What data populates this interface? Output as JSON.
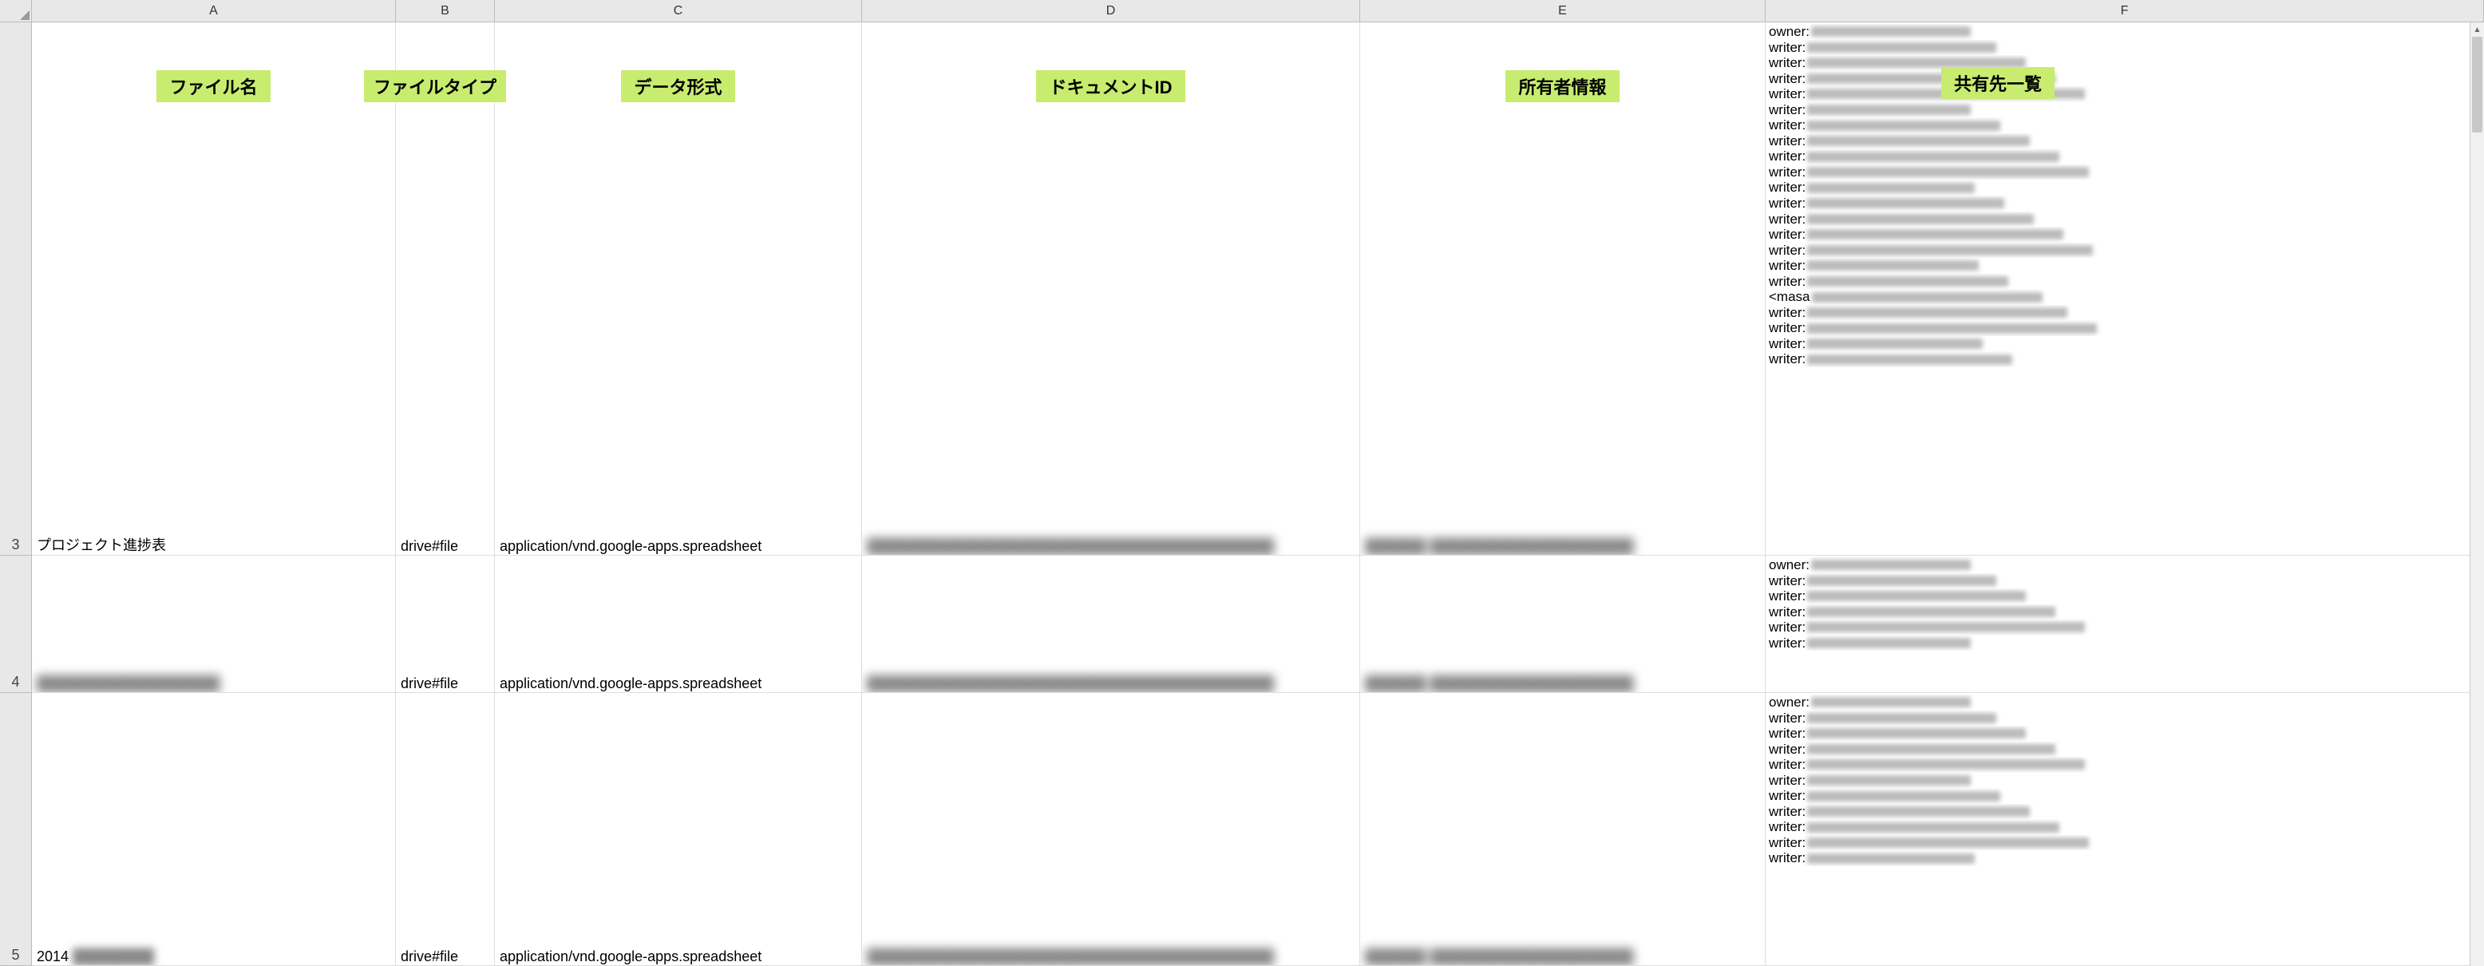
{
  "headers": {
    "A": "A",
    "B": "B",
    "C": "C",
    "D": "D",
    "E": "E",
    "F": "F"
  },
  "badges": {
    "A": "ファイル名",
    "B": "ファイルタイプ",
    "C": "データ形式",
    "D": "ドキュメントID",
    "E": "所有者情報",
    "F": "共有先一覧"
  },
  "rows": [
    {
      "num": "3",
      "A": "プロジェクト進捗表",
      "B": "drive#file",
      "C": "application/vnd.google-apps.spreadsheet",
      "D_blurred": true,
      "E_blurred": true,
      "F_prefixes": [
        "owner:",
        "writer:",
        "writer:",
        "writer:",
        "writer:",
        "writer:",
        "writer:",
        "writer:",
        "writer:",
        "writer:",
        "writer:",
        "writer:",
        "writer:",
        "writer:",
        "writer:",
        "writer:",
        "writer:",
        "<masa",
        "writer:",
        "writer:",
        "writer:",
        "writer:"
      ]
    },
    {
      "num": "4",
      "A_blurred": true,
      "B": "drive#file",
      "C": "application/vnd.google-apps.spreadsheet",
      "D_blurred": true,
      "E_blurred": true,
      "F_prefixes": [
        "owner:",
        "writer:",
        "writer:",
        "writer:",
        "writer:",
        "writer:"
      ]
    },
    {
      "num": "5",
      "A_prefix": "2014",
      "A_blurred_partial": true,
      "B": "drive#file",
      "C": "application/vnd.google-apps.spreadsheet",
      "D_blurred": true,
      "E_blurred": true,
      "F_prefixes": [
        "owner:",
        "writer:",
        "writer:",
        "writer:",
        "writer:",
        "writer:",
        "writer:",
        "writer:",
        "writer:",
        "writer:",
        "writer:"
      ]
    }
  ],
  "row_heights": [
    "668px",
    "172px",
    "342px"
  ]
}
